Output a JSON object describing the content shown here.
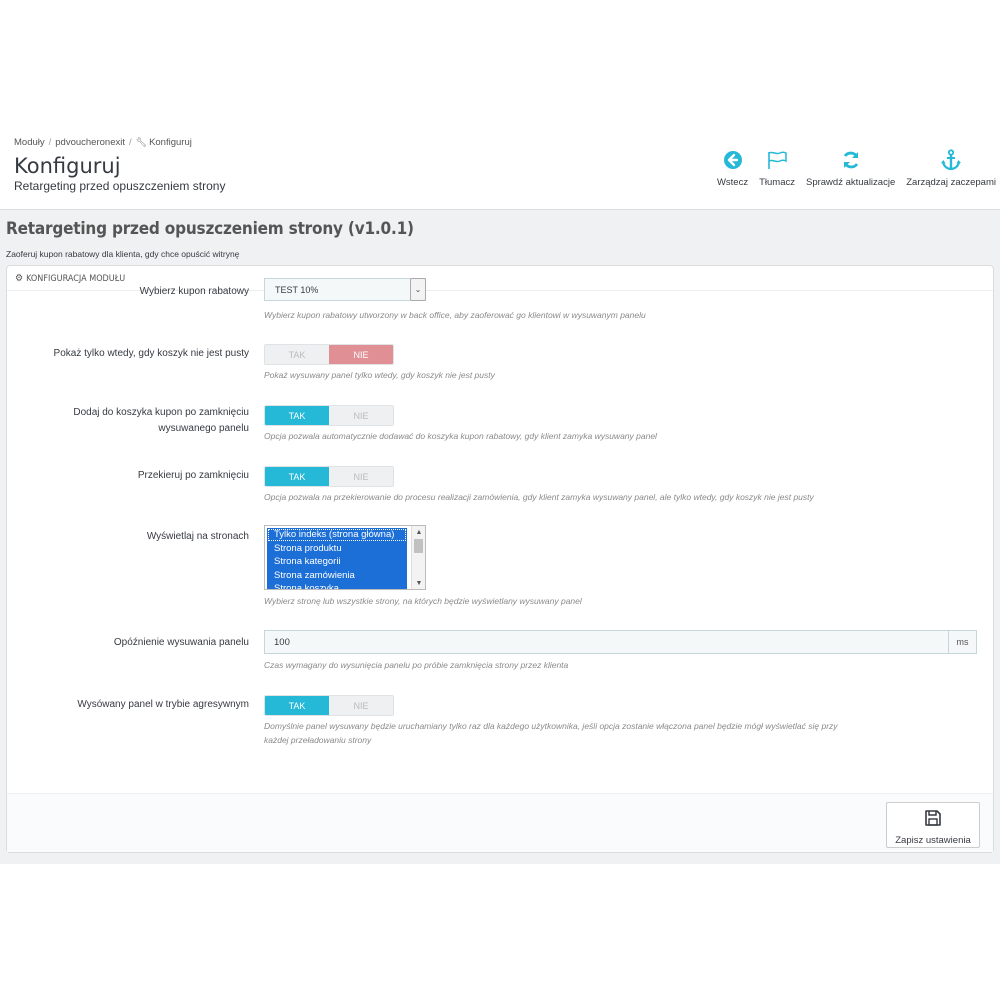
{
  "breadcrumb": {
    "item1": "Moduły",
    "item2": "pdvoucheronexit",
    "item3": "Konfiguruj"
  },
  "header": {
    "title": "Konfiguruj",
    "subtitle": "Retargeting przed opuszczeniem strony"
  },
  "toolbar": {
    "back_label": "Wstecz",
    "translate_label": "Tłumacz",
    "update_label": "Sprawdź aktualizacje",
    "hooks_label": "Zarządzaj zaczepami",
    "accent_color": "#25b9d7"
  },
  "module": {
    "title": "Retargeting przed opuszczeniem strony (v1.0.1)",
    "description": "Zaoferuj kupon rabatowy dla klienta, gdy chce opuścić witrynę"
  },
  "panel": {
    "heading": "KONFIGURACJA MODUŁU"
  },
  "fields": {
    "voucher": {
      "label": "Wybierz kupon rabatowy",
      "value": "TEST 10%",
      "help": "Wybierz kupon rabatowy utworzony w back office, aby zaoferować go klientowi w wysuwanym panelu"
    },
    "cart_not_empty": {
      "label": "Pokaż tylko wtedy, gdy koszyk nie jest pusty",
      "yes": "TAK",
      "no": "NIE",
      "selected": "NIE",
      "help": "Pokaż wysuwany panel tylko wtedy, gdy koszyk nie jest pusty"
    },
    "add_on_close": {
      "label_line1": "Dodaj do koszyka kupon po zamknięciu",
      "label_line2": "wysuwanego panelu",
      "yes": "TAK",
      "no": "NIE",
      "selected": "TAK",
      "help": "Opcja pozwala automatycznie dodawać do koszyka kupon rabatowy, gdy klient zamyka wysuwany panel"
    },
    "redirect": {
      "label": "Przekieruj po zamknięciu",
      "yes": "TAK",
      "no": "NIE",
      "selected": "TAK",
      "help": "Opcja pozwala na przekierowanie do procesu realizacji zamówienia, gdy klient zamyka wysuwany panel, ale tylko wtedy, gdy koszyk nie jest pusty"
    },
    "pages": {
      "label": "Wyświetlaj na stronach",
      "options": [
        "Tylko indeks (strona główna)",
        "Strona produktu",
        "Strona kategorii",
        "Strona zamówienia",
        "Strona koszyka"
      ],
      "help": "Wybierz stronę lub wszystkie strony, na których będzie wyświetlany wysuwany panel"
    },
    "delay": {
      "label": "Opóźnienie wysuwania panelu",
      "value": "100",
      "unit": "ms",
      "help": "Czas wymagany do wysunięcia panelu po próbie zamknięcia strony przez klienta"
    },
    "aggressive": {
      "label": "Wysówany panel w trybie agresywnym",
      "yes": "TAK",
      "no": "NIE",
      "selected": "TAK",
      "help_line1": "Domyślnie panel wysuwany będzie uruchamiany tylko raz dla każdego użytkownika, jeśli opcja zostanie włączona panel będzie mógł wyświetlać się przy",
      "help_line2": "każdej przeładowaniu strony"
    }
  },
  "footer": {
    "save_label": "Zapisz ustawienia"
  }
}
